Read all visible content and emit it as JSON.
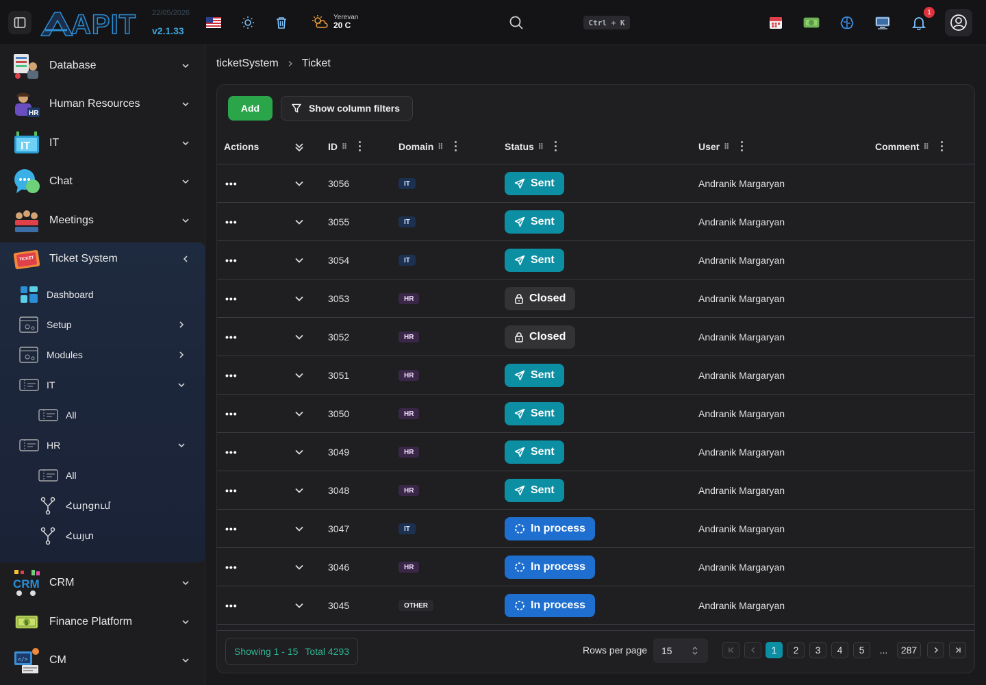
{
  "topbar": {
    "logo": "APIT",
    "date": "22/05/2026",
    "version": "v2.1.33",
    "weather_city": "Yerevan",
    "weather_temp": "20 C",
    "search_shortcut": "Ctrl + K",
    "notification_count": "1"
  },
  "sidebar": {
    "items": [
      {
        "label": "Database"
      },
      {
        "label": "Human Resources"
      },
      {
        "label": "IT"
      },
      {
        "label": "Chat"
      },
      {
        "label": "Meetings"
      },
      {
        "label": "Ticket System"
      },
      {
        "label": "CRM"
      },
      {
        "label": "Finance Platform"
      },
      {
        "label": "CM"
      }
    ],
    "ticket_sub": [
      {
        "label": "Dashboard"
      },
      {
        "label": "Setup"
      },
      {
        "label": "Modules"
      },
      {
        "label": "IT"
      },
      {
        "label": "All"
      },
      {
        "label": "HR"
      },
      {
        "label": "All"
      },
      {
        "label": "Հարցում"
      },
      {
        "label": "Հայտ"
      }
    ]
  },
  "breadcrumb": {
    "root": "ticketSystem",
    "current": "Ticket"
  },
  "toolbar": {
    "add_label": "Add",
    "filters_label": "Show column filters"
  },
  "table": {
    "columns": [
      "Actions",
      "ID",
      "Domain",
      "Status",
      "User",
      "Comment"
    ],
    "status_colors": {
      "Sent": "#0d8fa3",
      "Closed": "#333336",
      "In process": "#1f6fd0"
    },
    "rows": [
      {
        "id": "3056",
        "domain": "IT",
        "status": "Sent",
        "user": "Andranik Margaryan"
      },
      {
        "id": "3055",
        "domain": "IT",
        "status": "Sent",
        "user": "Andranik Margaryan"
      },
      {
        "id": "3054",
        "domain": "IT",
        "status": "Sent",
        "user": "Andranik Margaryan"
      },
      {
        "id": "3053",
        "domain": "HR",
        "status": "Closed",
        "user": "Andranik Margaryan"
      },
      {
        "id": "3052",
        "domain": "HR",
        "status": "Closed",
        "user": "Andranik Margaryan"
      },
      {
        "id": "3051",
        "domain": "HR",
        "status": "Sent",
        "user": "Andranik Margaryan"
      },
      {
        "id": "3050",
        "domain": "HR",
        "status": "Sent",
        "user": "Andranik Margaryan"
      },
      {
        "id": "3049",
        "domain": "HR",
        "status": "Sent",
        "user": "Andranik Margaryan"
      },
      {
        "id": "3048",
        "domain": "HR",
        "status": "Sent",
        "user": "Andranik Margaryan"
      },
      {
        "id": "3047",
        "domain": "IT",
        "status": "In process",
        "user": "Andranik Margaryan"
      },
      {
        "id": "3046",
        "domain": "HR",
        "status": "In process",
        "user": "Andranik Margaryan"
      },
      {
        "id": "3045",
        "domain": "OTHER",
        "status": "In process",
        "user": "Andranik Margaryan"
      }
    ]
  },
  "footer": {
    "showing": "Showing 1 - 15",
    "total": "Total 4293",
    "rows_per_page_label": "Rows per page",
    "rows_per_page_value": "15",
    "pages": [
      "1",
      "2",
      "3",
      "4",
      "5",
      "...",
      "287"
    ],
    "current_page": "1"
  }
}
